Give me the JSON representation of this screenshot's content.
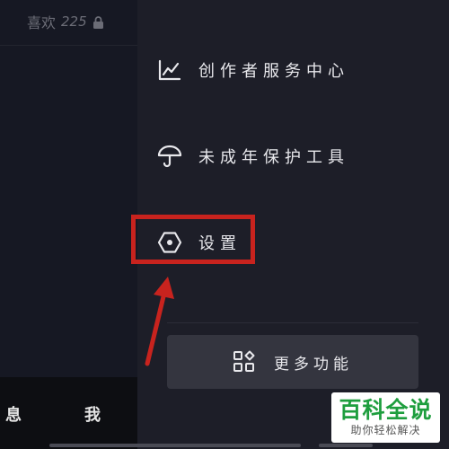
{
  "profile": {
    "likes_label": "喜欢",
    "likes_count": "225"
  },
  "bottom_nav": {
    "messages_label": "息",
    "me_label": "我"
  },
  "drawer": {
    "items": [
      {
        "label": "创作者服务中心",
        "icon": "chart-line-icon"
      },
      {
        "label": "未成年保护工具",
        "icon": "umbrella-icon"
      },
      {
        "label": "设置",
        "icon": "hexagon-settings-icon"
      }
    ],
    "more_button": {
      "label": "更多功能",
      "icon": "grid-apps-icon"
    }
  },
  "annotation": {
    "color": "#c8231e",
    "target": "设置"
  },
  "watermark": {
    "title": "百科全说",
    "subtitle": "助你轻松解决"
  },
  "colors": {
    "background": "#161823",
    "drawer": "#1d1e28",
    "button": "#34353f",
    "text": "#e8e8ec",
    "watermark_green": "#1e9e3e"
  }
}
